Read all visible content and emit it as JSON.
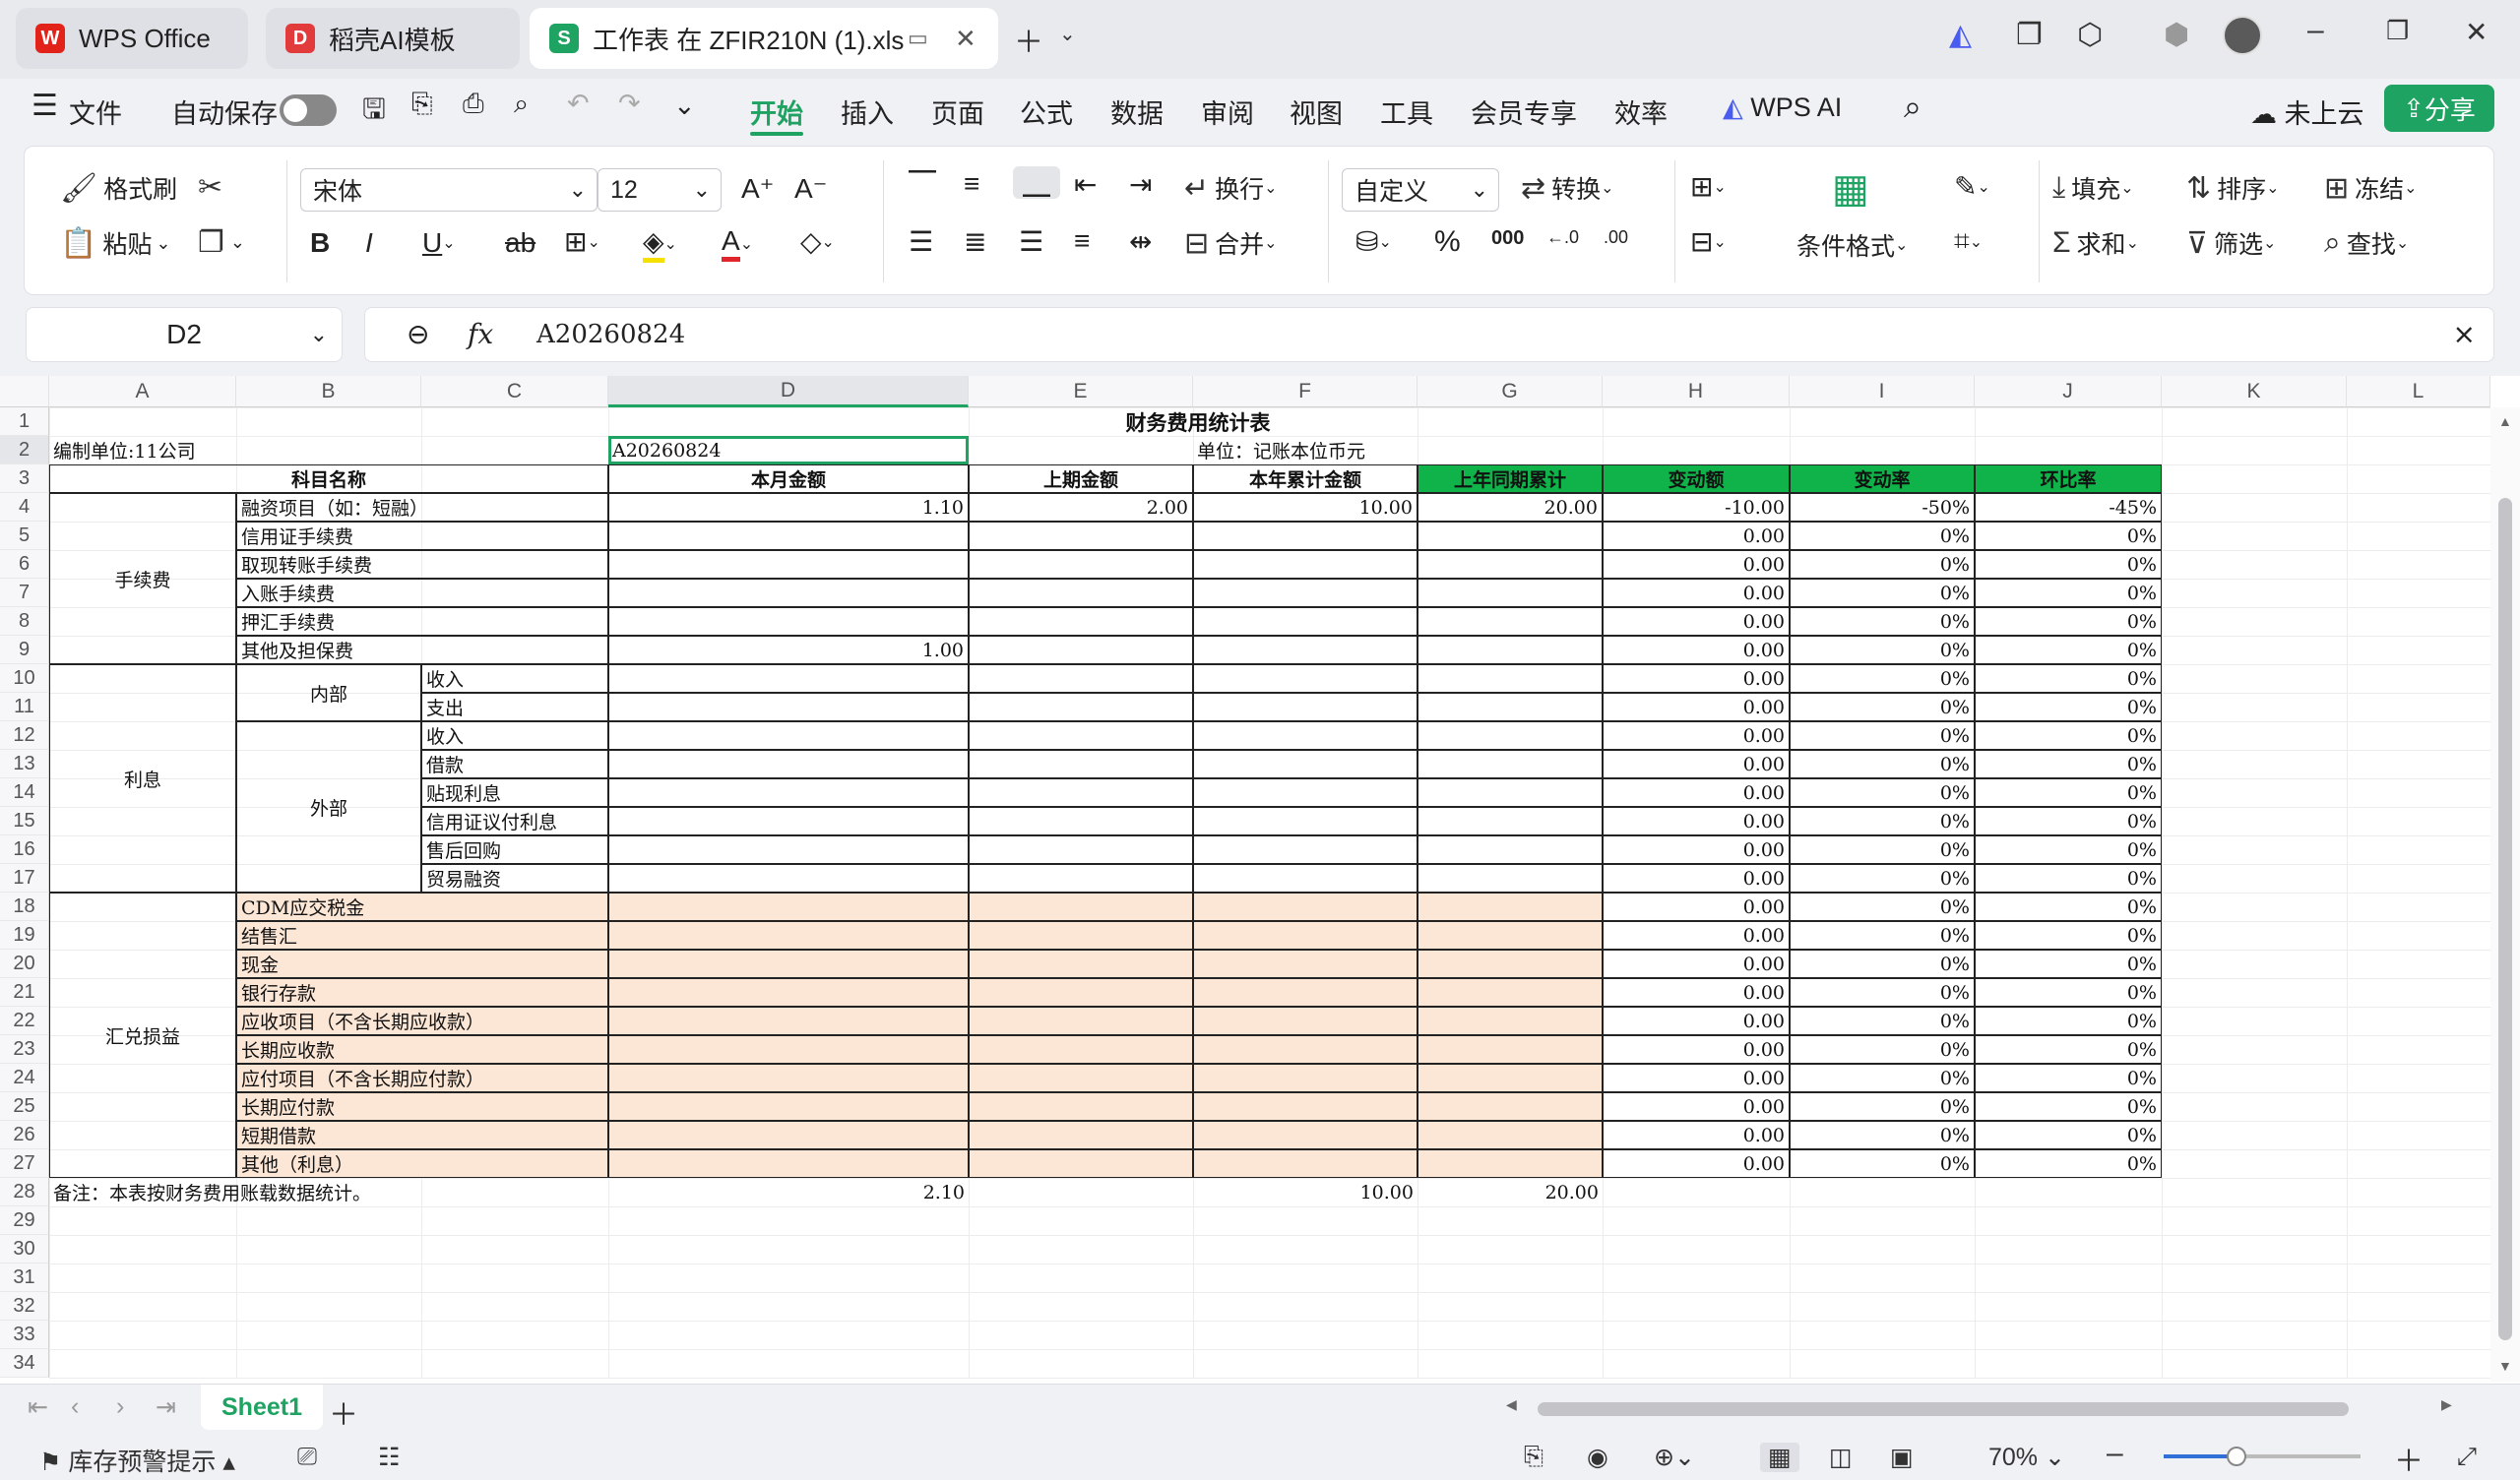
{
  "titlebar": {
    "tabs": [
      {
        "label": "WPS Office",
        "icon": "wps-logo-icon",
        "color": "#e2231a"
      },
      {
        "label": "稻壳AI模板",
        "icon": "daoke-icon",
        "color": "#e23b3b"
      },
      {
        "label": "工作表 在 ZFIR210N (1).xls",
        "icon": "sheet-s-icon",
        "color": "#1ea362"
      }
    ]
  },
  "menubar": {
    "file": "文件",
    "autosave": "自动保存",
    "tabs": [
      "开始",
      "插入",
      "页面",
      "公式",
      "数据",
      "审阅",
      "视图",
      "工具",
      "会员专享",
      "效率"
    ],
    "active_tab": "开始",
    "wps_ai": "WPS AI",
    "cloud": "未上云",
    "share": "分享",
    "accent": "#1ea362"
  },
  "ribbon": {
    "format_painter": "格式刷",
    "paste": "粘贴",
    "font": "宋体",
    "size": "12",
    "wrap": "换行",
    "merge": "合并",
    "number_format": "自定义",
    "convert": "转换",
    "cond_format": "条件格式",
    "fill": "填充",
    "sort": "排序",
    "freeze": "冻结",
    "sum": "求和",
    "filter": "筛选",
    "find": "查找",
    "percent": "%",
    "thousands": "000"
  },
  "formula": {
    "namebox": "D2",
    "fx": "fx",
    "content": "A20260824"
  },
  "columns": [
    "A",
    "B",
    "C",
    "D",
    "E",
    "F",
    "G",
    "H",
    "I",
    "J",
    "K",
    "L"
  ],
  "rows": [
    "1",
    "2",
    "3",
    "4",
    "5",
    "6",
    "7",
    "8",
    "9",
    "10",
    "11",
    "12",
    "13",
    "14",
    "15",
    "16",
    "17",
    "18",
    "19",
    "20",
    "21",
    "22",
    "23",
    "24",
    "25",
    "26",
    "27",
    "28",
    "29",
    "30",
    "31",
    "32",
    "33",
    "34"
  ],
  "sheet": {
    "title": "财务费用统计表",
    "unit_org": "编制单位:11公司",
    "doc_no": "A20260824",
    "unit_currency": "单位：记账本位币元",
    "headers": [
      "科目名称",
      "本月金额",
      "上期金额",
      "本年累计金额",
      "上年同期累计",
      "变动额",
      "变动率",
      "环比率"
    ],
    "groups": [
      "手续费",
      "利息",
      "汇兑损益"
    ],
    "subgroups": [
      "内部",
      "外部"
    ],
    "items": [
      {
        "name": "融资项目（如：短融）",
        "d": "1.10",
        "e": "2.00",
        "f": "10.00",
        "g": "20.00",
        "h": "-10.00",
        "i": "-50%",
        "j": "-45%"
      },
      {
        "name": "信用证手续费",
        "h": "0.00",
        "i": "0%",
        "j": "0%"
      },
      {
        "name": "取现转账手续费",
        "h": "0.00",
        "i": "0%",
        "j": "0%"
      },
      {
        "name": "入账手续费",
        "h": "0.00",
        "i": "0%",
        "j": "0%"
      },
      {
        "name": "押汇手续费",
        "h": "0.00",
        "i": "0%",
        "j": "0%"
      },
      {
        "name": "其他及担保费",
        "d": "1.00",
        "h": "0.00",
        "i": "0%",
        "j": "0%"
      },
      {
        "name": "收入",
        "h": "0.00",
        "i": "0%",
        "j": "0%"
      },
      {
        "name": "支出",
        "h": "0.00",
        "i": "0%",
        "j": "0%"
      },
      {
        "name": "收入",
        "h": "0.00",
        "i": "0%",
        "j": "0%"
      },
      {
        "name": "借款",
        "h": "0.00",
        "i": "0%",
        "j": "0%"
      },
      {
        "name": "贴现利息",
        "h": "0.00",
        "i": "0%",
        "j": "0%"
      },
      {
        "name": "信用证议付利息",
        "h": "0.00",
        "i": "0%",
        "j": "0%"
      },
      {
        "name": "售后回购",
        "h": "0.00",
        "i": "0%",
        "j": "0%"
      },
      {
        "name": "贸易融资",
        "h": "0.00",
        "i": "0%",
        "j": "0%"
      },
      {
        "name": "CDM应交税金",
        "h": "0.00",
        "i": "0%",
        "j": "0%"
      },
      {
        "name": "结售汇",
        "h": "0.00",
        "i": "0%",
        "j": "0%"
      },
      {
        "name": "现金",
        "h": "0.00",
        "i": "0%",
        "j": "0%"
      },
      {
        "name": "银行存款",
        "h": "0.00",
        "i": "0%",
        "j": "0%"
      },
      {
        "name": "应收项目（不含长期应收款）",
        "h": "0.00",
        "i": "0%",
        "j": "0%"
      },
      {
        "name": "长期应收款",
        "h": "0.00",
        "i": "0%",
        "j": "0%"
      },
      {
        "name": "应付项目（不含长期应付款）",
        "h": "0.00",
        "i": "0%",
        "j": "0%"
      },
      {
        "name": "长期应付款",
        "h": "0.00",
        "i": "0%",
        "j": "0%"
      },
      {
        "name": "短期借款",
        "h": "0.00",
        "i": "0%",
        "j": "0%"
      },
      {
        "name": "其他（利息）",
        "h": "0.00",
        "i": "0%",
        "j": "0%"
      }
    ],
    "footer": {
      "note": "备注：本表按财务费用账载数据统计。",
      "d": "2.10",
      "f": "10.00",
      "g": "20.00"
    },
    "header_green": "#0fb34a",
    "fx_fill": "#fce6d6"
  },
  "sheetbar": {
    "tab": "Sheet1"
  },
  "statusbar": {
    "stock_alert": "库存预警提示",
    "zoom": "70%"
  }
}
